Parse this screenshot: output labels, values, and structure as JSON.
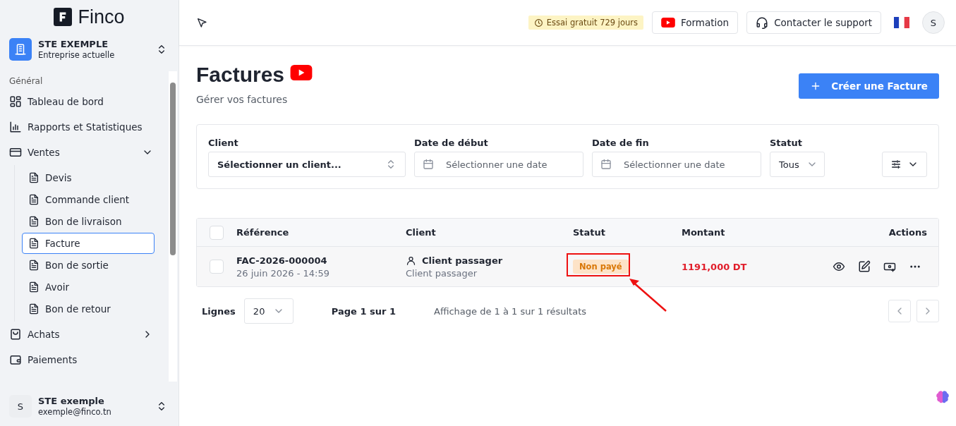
{
  "logo": {
    "text": "Finco"
  },
  "company": {
    "name": "STE EXEMPLE",
    "subtitle": "Entreprise actuelle"
  },
  "sidebar": {
    "section": "Général",
    "items": [
      {
        "label": "Tableau de bord"
      },
      {
        "label": "Rapports et Statistiques"
      },
      {
        "label": "Ventes",
        "expanded": true,
        "children": [
          {
            "label": "Devis",
            "selected": false
          },
          {
            "label": "Commande client",
            "selected": false
          },
          {
            "label": "Bon de livraison",
            "selected": false
          },
          {
            "label": "Facture",
            "selected": true
          },
          {
            "label": "Bon de sortie",
            "selected": false
          },
          {
            "label": "Avoir",
            "selected": false
          },
          {
            "label": "Bon de retour",
            "selected": false
          }
        ]
      },
      {
        "label": "Achats",
        "expanded": false
      },
      {
        "label": "Paiements"
      }
    ]
  },
  "user": {
    "initial": "S",
    "name": "STE exemple",
    "email": "exemple@finco.tn"
  },
  "header": {
    "trial": "Essai gratuit 729 jours",
    "formation": "Formation",
    "support": "Contacter le support",
    "avatar": "S"
  },
  "page": {
    "title": "Factures",
    "subtitle": "Gérer vos factures",
    "create_button": "Créer une Facture"
  },
  "filters": [
    {
      "kind": "select",
      "label": "Client",
      "value": "Sélectionner un client..."
    },
    {
      "kind": "date",
      "label": "Date de début",
      "placeholder": "Sélectionner une date"
    },
    {
      "kind": "date",
      "label": "Date de fin",
      "placeholder": "Sélectionner une date"
    },
    {
      "kind": "dropdown",
      "label": "Statut",
      "value": "Tous"
    }
  ],
  "table": {
    "select_all_checked": false,
    "columns": [
      "Référence",
      "Client",
      "Statut",
      "Montant",
      "Actions"
    ],
    "rows": [
      {
        "checked": false,
        "reference": "FAC-2026-000004",
        "date": "26 juin 2026 - 14:59",
        "client": "Client passager",
        "client_sub": "Client passager",
        "status": "Non payé",
        "amount": "1191,000 DT"
      }
    ]
  },
  "pagination": {
    "rows_label": "Lignes",
    "rows_value": "20",
    "page": "Page 1 sur 1",
    "summary": "Affichage de 1 à 1 sur 1 résultats"
  }
}
